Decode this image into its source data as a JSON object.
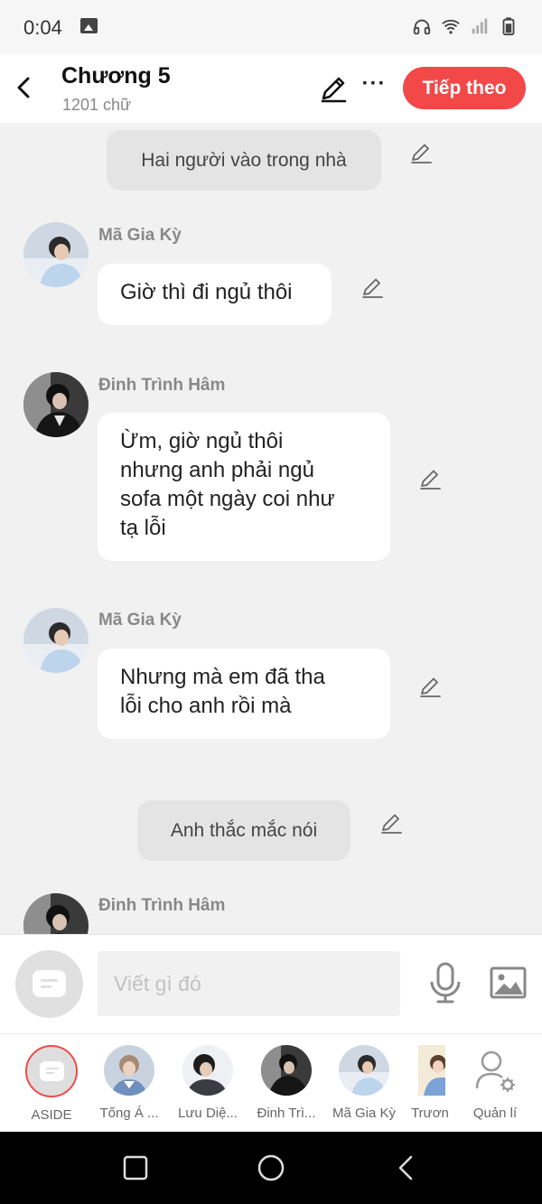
{
  "status": {
    "time": "0:04"
  },
  "header": {
    "title": "Chương 5",
    "word_count": "1201 chữ",
    "next_label": "Tiếp theo",
    "more_label": "···"
  },
  "chat": {
    "narration_1": "Hai người vào trong nhà",
    "m1_speaker": "Mã Gia Kỳ",
    "m1_text": "Giờ thì đi ngủ thôi",
    "m2_speaker": "Đinh Trình Hâm",
    "m2_line1": "Ừm, giờ ngủ thôi",
    "m2_line2": "nhưng anh phải ngủ",
    "m2_line3": "sofa một ngày coi như",
    "m2_line4": "tạ lỗi",
    "m3_speaker": "Mã Gia Kỳ",
    "m3_line1": "Nhưng mà em đã tha",
    "m3_line2": "lỗi cho anh rồi mà",
    "narration_2": "Anh thắc mắc nói",
    "m4_speaker": "Đinh Trình Hâm"
  },
  "input": {
    "placeholder": "Viết gì đó"
  },
  "characters": {
    "aside": "ASIDE",
    "c1": "Tống Á ...",
    "c2": "Lưu Diệ...",
    "c3": "Đinh Trì...",
    "c4": "Mã Gia Kỳ",
    "c5": "Trươn",
    "manage": "Quản lí"
  },
  "colors": {
    "accent": "#f24848",
    "background": "#f1f1f1",
    "bubble": "#ffffff",
    "narration": "#e4e4e4"
  }
}
